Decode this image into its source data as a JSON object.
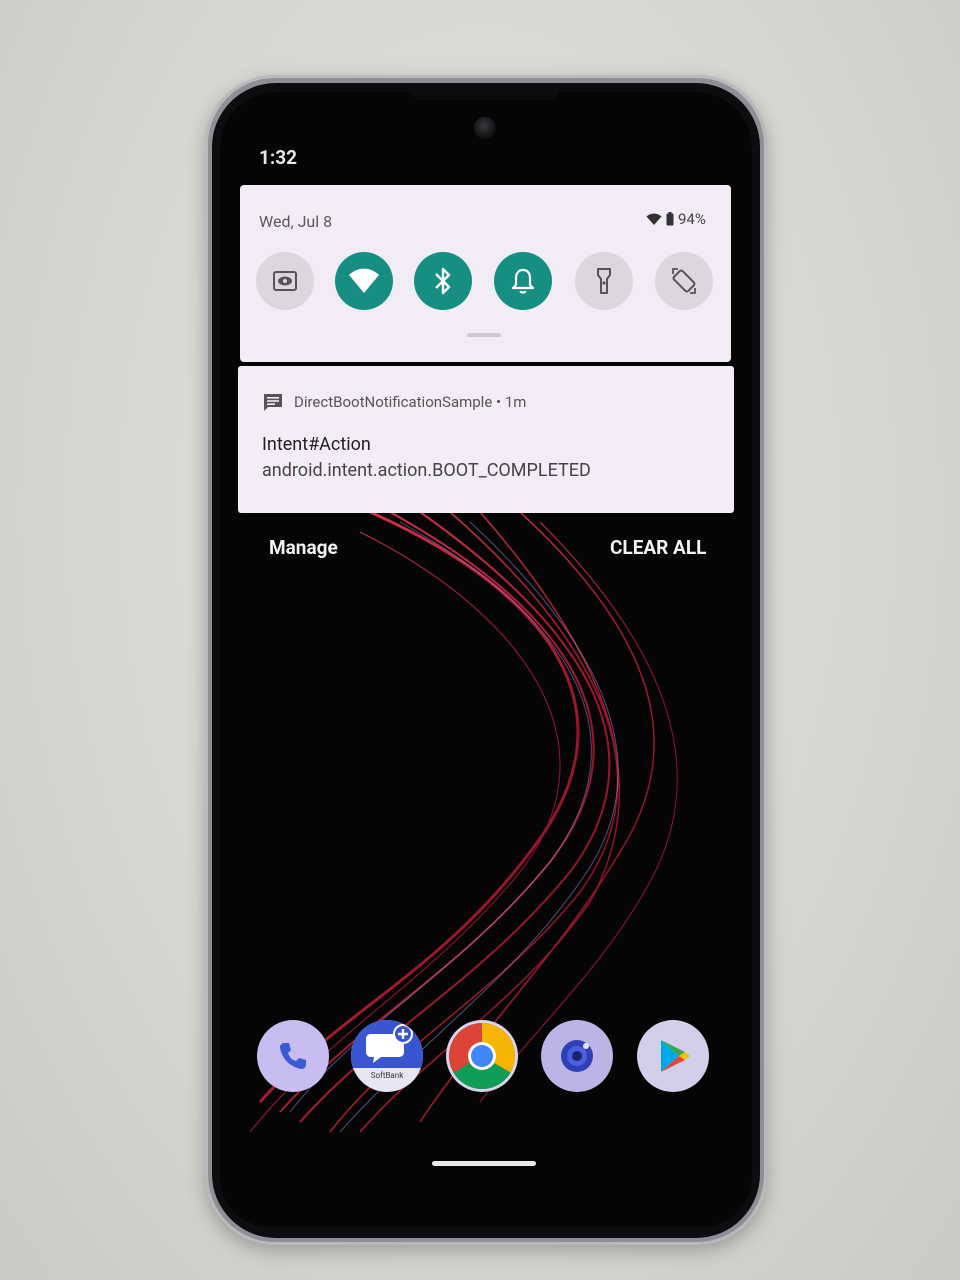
{
  "status_bar": {
    "time": "1:32"
  },
  "quick_settings": {
    "date": "Wed, Jul 8",
    "battery": "94%",
    "tiles": [
      {
        "name": "screen-saver",
        "state": "off",
        "icon": "eye-icon"
      },
      {
        "name": "wifi",
        "state": "on",
        "icon": "wifi-icon"
      },
      {
        "name": "bluetooth",
        "state": "on",
        "icon": "bluetooth-icon"
      },
      {
        "name": "sound",
        "state": "on",
        "icon": "bell-icon"
      },
      {
        "name": "flashlight",
        "state": "off",
        "icon": "flashlight-icon"
      },
      {
        "name": "auto-rotate",
        "state": "off",
        "icon": "rotate-icon"
      }
    ]
  },
  "notification": {
    "app": "DirectBootNotificationSample",
    "separator": "•",
    "time": "1m",
    "title": "Intent#Action",
    "body": "android.intent.action.BOOT_COMPLETED"
  },
  "shade_actions": {
    "manage": "Manage",
    "clear_all": "CLEAR ALL"
  },
  "dock": {
    "apps": [
      "phone",
      "messages",
      "chrome",
      "camera",
      "play-store"
    ],
    "messages_sublabel": "SoftBank"
  },
  "colors": {
    "tile_on": "#168f82",
    "tile_off": "#dcd7dd",
    "panel_bg": "#f1ecf5",
    "wallpaper_accent": "#c8203a"
  }
}
